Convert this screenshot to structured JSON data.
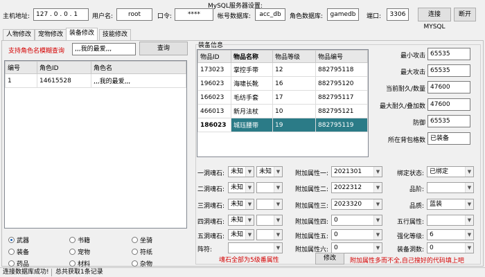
{
  "server": {
    "group_title": "MySQL服务器设置:",
    "host_label": "主机地址:",
    "host_value": "127 . 0 . 0 . 1",
    "user_label": "用户名:",
    "user_value": "root",
    "pwd_label": "口令:",
    "pwd_value": "****",
    "acc_db_label": "帐号数据库:",
    "acc_db_value": "acc_db",
    "role_db_label": "角色数据库:",
    "role_db_value": "gamedb",
    "port_label": "端口:",
    "port_value": "3306",
    "connect_button": "连接MYSQL",
    "disconnect_button": "断开"
  },
  "tabs": [
    "人物修改",
    "宠物修改",
    "装备修改",
    "技能修改"
  ],
  "left": {
    "search_hint": "支持角色名模糊查询",
    "search_value": ",,,我的最爱,,,",
    "query_button": "查询",
    "columns": [
      "编号",
      "角色ID",
      "角色名"
    ],
    "rows": [
      [
        "1",
        "14615528",
        ",,,我的最爱,,,"
      ]
    ],
    "radios": [
      "武器",
      "书籍",
      "坐骑",
      "装备",
      "宠物",
      "符纸",
      "药品",
      "材料",
      "杂物"
    ]
  },
  "equip": {
    "group_title": "装备信息",
    "columns": [
      "物品ID",
      "物品名称",
      "物品等级",
      "物品编号"
    ],
    "rows": [
      [
        "173023",
        "掌控手带",
        "12",
        "882795118"
      ],
      [
        "196023",
        "海啸长靴",
        "16",
        "882795120"
      ],
      [
        "166023",
        "毛纺手套",
        "17",
        "882795117"
      ],
      [
        "466013",
        "新月法杖",
        "10",
        "882795121"
      ],
      [
        "186023",
        "城珏腰带",
        "19",
        "882795119"
      ]
    ],
    "selected_row": 4
  },
  "stats": {
    "min_attack_label": "最小攻击",
    "min_attack_value": "65535",
    "max_attack_label": "最大攻击",
    "max_attack_value": "65535",
    "cur_dur_label": "当前耐久/数量",
    "cur_dur_value": "47600",
    "max_dur_label": "最大耐久/叠加数",
    "max_dur_value": "47600",
    "defense_label": "防御",
    "defense_value": "65535",
    "bag_label": "所在背包格数",
    "bag_value": "已装备"
  },
  "gems": {
    "labels": [
      "一洞魂石:",
      "二洞魂石:",
      "三洞魂石:",
      "四洞魂石:",
      "五洞魂石:"
    ],
    "slot1": [
      "未知",
      "未知"
    ],
    "slot2": [
      "未知",
      ""
    ],
    "slot3": [
      "未知",
      ""
    ],
    "slot4": [
      "未知",
      ""
    ],
    "slot5": [
      "未知",
      ""
    ],
    "rune_label": "阵符:",
    "rune_value": "",
    "note": "魂石全部为5级番属性"
  },
  "attrs": {
    "labels": [
      "附加属性一:",
      "附加属性二:",
      "附加属性三:",
      "附加属性四:",
      "附加属性五:",
      "附加属性六:"
    ],
    "values": [
      "2021301",
      "2022312",
      "2023320",
      "0",
      "0",
      "0"
    ],
    "modify_button": "修改",
    "note": "附加属性多而不全,自己搜好的代码填上吧"
  },
  "right_props": {
    "labels": [
      "绑定状态:",
      "品阶:",
      "品质:",
      "五行属性:",
      "强化等级:",
      "装备洞数:"
    ],
    "values": [
      "已绑定",
      "",
      "蓝装",
      "",
      "6",
      "0"
    ]
  },
  "status": {
    "left": "连接数据库成功!",
    "right": "总共获取1条记录"
  },
  "colors": {
    "selected_row": "#2b7b87",
    "red_text": "#d40000"
  }
}
